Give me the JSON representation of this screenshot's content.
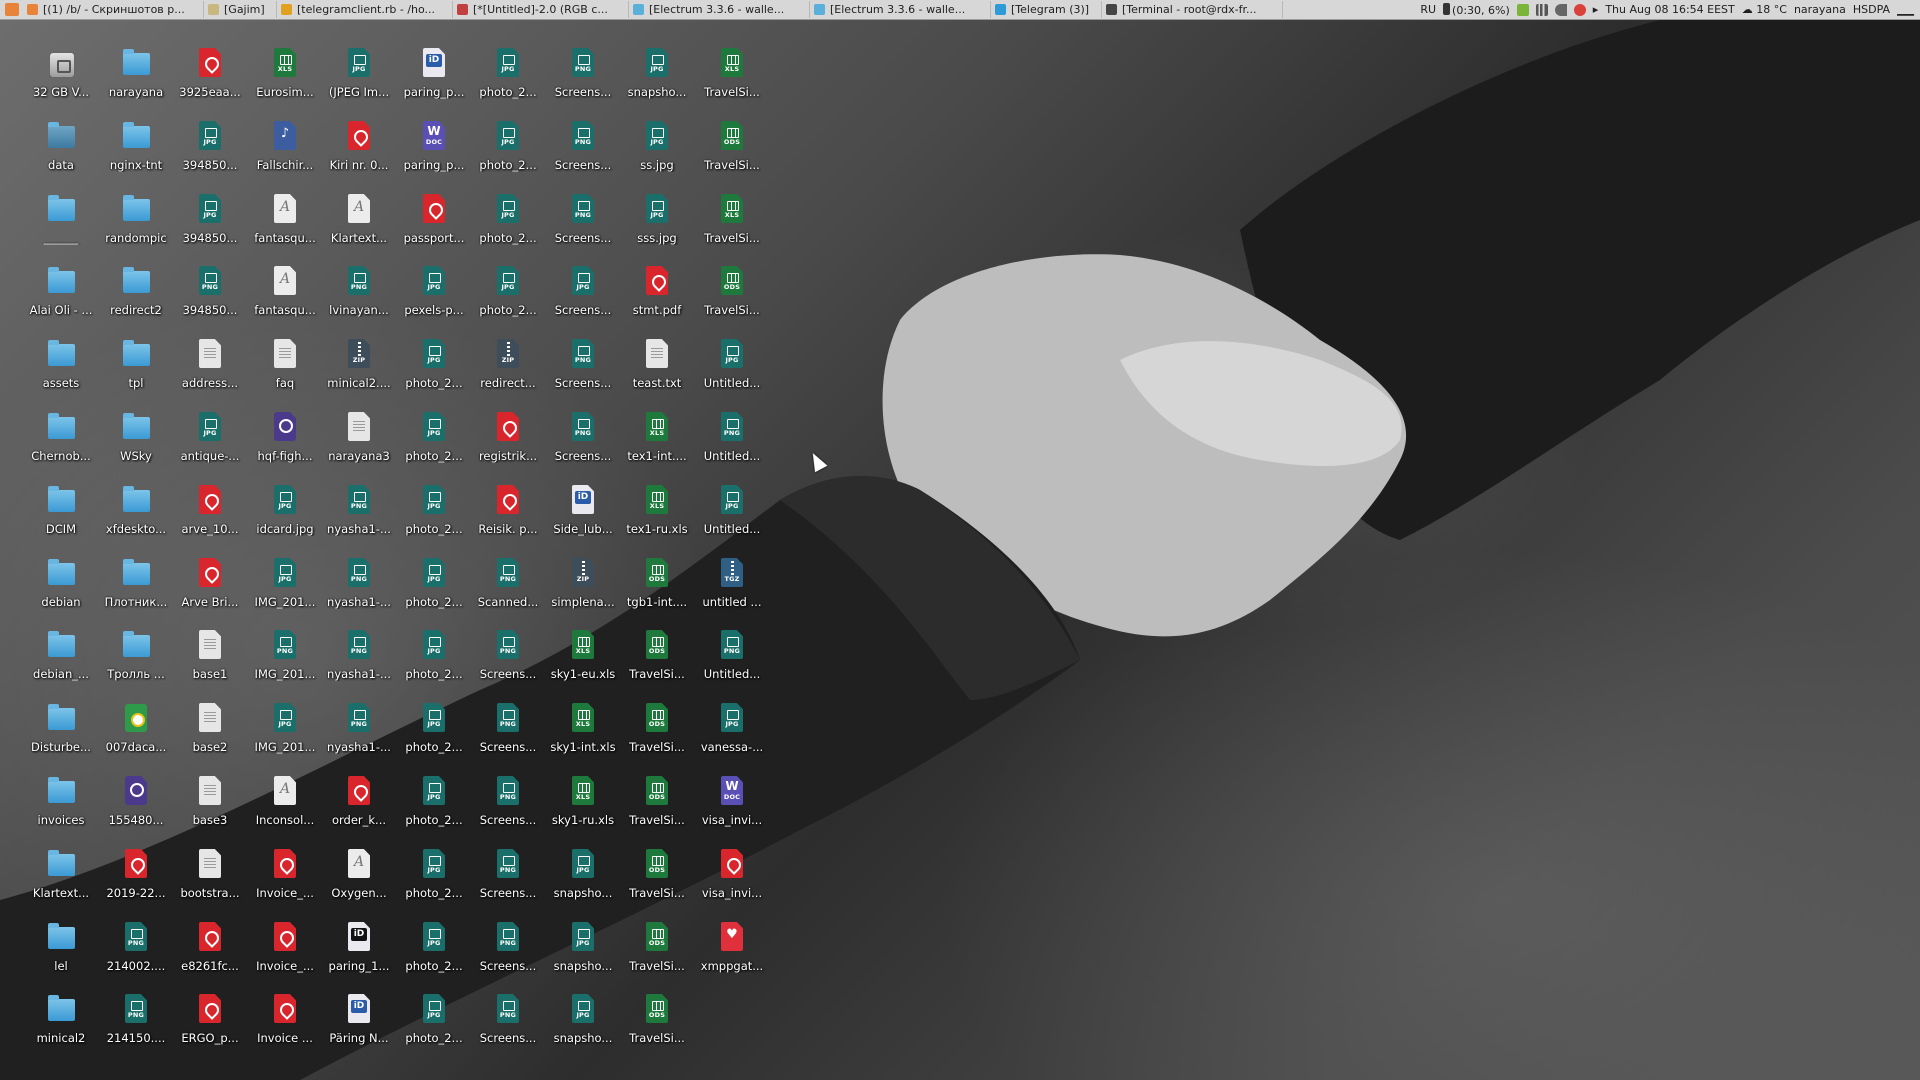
{
  "topbar": {
    "tasks": [
      {
        "label": "[(1) /b/ - Скриншотов р...",
        "icon": "browser-icon",
        "color": "#e8833a"
      },
      {
        "label": "[Gajim]",
        "icon": "chat-icon",
        "color": "#c8b880"
      },
      {
        "label": "[telegramclient.rb - /ho...",
        "icon": "editor-icon",
        "color": "#e0a020"
      },
      {
        "label": "[*[Untitled]-2.0 (RGB c...",
        "icon": "gimp-icon",
        "color": "#c04040"
      },
      {
        "label": "[Electrum 3.3.6 - walle...",
        "icon": "electrum-icon",
        "color": "#5ab0d8"
      },
      {
        "label": "[Electrum 3.3.6 - walle...",
        "icon": "electrum-icon",
        "color": "#5ab0d8"
      },
      {
        "label": "[Telegram (3)]",
        "icon": "telegram-icon",
        "color": "#2f9ad8"
      },
      {
        "label": "[Terminal - root@rdx-fr...",
        "icon": "terminal-icon",
        "color": "#444444"
      }
    ],
    "keyboard_layout": "RU",
    "battery": "(0:30, 6%)",
    "clock": "Thu Aug 08 16:54 EEST",
    "weather": "18 °C",
    "user": "narayana",
    "network": "HSDPA"
  },
  "desktop": {
    "columns": [
      [
        {
          "label": "32 GB V...",
          "type": "drive"
        },
        {
          "label": "data",
          "type": "netfolder"
        },
        {
          "label": "______",
          "type": "folder"
        },
        {
          "label": "Alai Oli - ...",
          "type": "folder"
        },
        {
          "label": "assets",
          "type": "folder"
        },
        {
          "label": "Chernob...",
          "type": "folder"
        },
        {
          "label": "DCIM",
          "type": "folder"
        },
        {
          "label": "debian",
          "type": "folder"
        },
        {
          "label": "debian_...",
          "type": "folder"
        },
        {
          "label": "Disturbe...",
          "type": "folder"
        },
        {
          "label": "invoices",
          "type": "folder"
        },
        {
          "label": "Klartext...",
          "type": "folder"
        },
        {
          "label": "lel",
          "type": "folder"
        },
        {
          "label": "minical2",
          "type": "folder"
        }
      ],
      [
        {
          "label": "narayana",
          "type": "folder"
        },
        {
          "label": "nginx-tnt",
          "type": "folder"
        },
        {
          "label": "randompic",
          "type": "folder"
        },
        {
          "label": "redirect2",
          "type": "folder"
        },
        {
          "label": "tpl",
          "type": "folder"
        },
        {
          "label": "WSky",
          "type": "folder"
        },
        {
          "label": "xfdeskto...",
          "type": "folder"
        },
        {
          "label": "Плотник...",
          "type": "folder"
        },
        {
          "label": "Тролль ...",
          "type": "folder"
        },
        {
          "label": "007daca...",
          "type": "chrome"
        },
        {
          "label": "155480...",
          "type": "video"
        },
        {
          "label": "2019-22...",
          "type": "pdf"
        },
        {
          "label": "214002....",
          "type": "png"
        },
        {
          "label": "214150....",
          "type": "png"
        }
      ],
      [
        {
          "label": "3925eaa...",
          "type": "pdf"
        },
        {
          "label": "394850...",
          "type": "jpg"
        },
        {
          "label": "394850...",
          "type": "jpg"
        },
        {
          "label": "394850...",
          "type": "png"
        },
        {
          "label": "address...",
          "type": "txt"
        },
        {
          "label": "antique-...",
          "type": "jpg"
        },
        {
          "label": "arve_10...",
          "type": "pdf"
        },
        {
          "label": "Arve Bri...",
          "type": "pdf"
        },
        {
          "label": "base1",
          "type": "txt"
        },
        {
          "label": "base2",
          "type": "txt"
        },
        {
          "label": "base3",
          "type": "txt"
        },
        {
          "label": "bootstra...",
          "type": "txt"
        },
        {
          "label": "e8261fc...",
          "type": "pdf"
        },
        {
          "label": "ERGO_p...",
          "type": "pdf"
        }
      ],
      [
        {
          "label": "Eurosim...",
          "type": "xls"
        },
        {
          "label": "Fallschir...",
          "type": "audio"
        },
        {
          "label": "fantasqu...",
          "type": "font"
        },
        {
          "label": "fantasqu...",
          "type": "font"
        },
        {
          "label": "faq",
          "type": "txt"
        },
        {
          "label": "hqf-figh...",
          "type": "video"
        },
        {
          "label": "idcard.jpg",
          "type": "jpg"
        },
        {
          "label": "IMG_201...",
          "type": "jpg"
        },
        {
          "label": "IMG_201...",
          "type": "png"
        },
        {
          "label": "IMG_201...",
          "type": "jpg"
        },
        {
          "label": "Inconsol...",
          "type": "font"
        },
        {
          "label": "Invoice_...",
          "type": "pdf"
        },
        {
          "label": "Invoice_...",
          "type": "pdf"
        },
        {
          "label": "Invoice ...",
          "type": "pdf"
        }
      ],
      [
        {
          "label": "(JPEG Im...",
          "type": "jpg"
        },
        {
          "label": "Kiri nr. 0...",
          "type": "pdf"
        },
        {
          "label": "Klartext...",
          "type": "font"
        },
        {
          "label": "lvinayan...",
          "type": "png"
        },
        {
          "label": "minical2....",
          "type": "zip"
        },
        {
          "label": "narayana3",
          "type": "txt"
        },
        {
          "label": "nyasha1-...",
          "type": "png"
        },
        {
          "label": "nyasha1-...",
          "type": "png"
        },
        {
          "label": "nyasha1-...",
          "type": "png"
        },
        {
          "label": "nyasha1-...",
          "type": "png"
        },
        {
          "label": "order_k...",
          "type": "pdf"
        },
        {
          "label": "Oxygen...",
          "type": "font"
        },
        {
          "label": "paring_1...",
          "type": "idcard2"
        },
        {
          "label": "Päring N...",
          "type": "idcard"
        }
      ],
      [
        {
          "label": "paring_p...",
          "type": "idcard"
        },
        {
          "label": "paring_p...",
          "type": "word"
        },
        {
          "label": "passport...",
          "type": "pdf"
        },
        {
          "label": "pexels-p...",
          "type": "jpg"
        },
        {
          "label": "photo_2...",
          "type": "jpg"
        },
        {
          "label": "photo_2...",
          "type": "jpg"
        },
        {
          "label": "photo_2...",
          "type": "jpg"
        },
        {
          "label": "photo_2...",
          "type": "jpg"
        },
        {
          "label": "photo_2...",
          "type": "jpg"
        },
        {
          "label": "photo_2...",
          "type": "jpg"
        },
        {
          "label": "photo_2...",
          "type": "jpg"
        },
        {
          "label": "photo_2...",
          "type": "jpg"
        },
        {
          "label": "photo_2...",
          "type": "jpg"
        },
        {
          "label": "photo_2...",
          "type": "jpg"
        }
      ],
      [
        {
          "label": "photo_2...",
          "type": "jpg"
        },
        {
          "label": "photo_2...",
          "type": "jpg"
        },
        {
          "label": "photo_2...",
          "type": "jpg"
        },
        {
          "label": "photo_2...",
          "type": "jpg"
        },
        {
          "label": "redirect...",
          "type": "zip"
        },
        {
          "label": "registrik...",
          "type": "pdf"
        },
        {
          "label": "Reisik. p...",
          "type": "pdf"
        },
        {
          "label": "Scanned...",
          "type": "png"
        },
        {
          "label": "Screens...",
          "type": "png"
        },
        {
          "label": "Screens...",
          "type": "png"
        },
        {
          "label": "Screens...",
          "type": "png"
        },
        {
          "label": "Screens...",
          "type": "png"
        },
        {
          "label": "Screens...",
          "type": "png"
        },
        {
          "label": "Screens...",
          "type": "png"
        }
      ],
      [
        {
          "label": "Screens...",
          "type": "png"
        },
        {
          "label": "Screens...",
          "type": "png"
        },
        {
          "label": "Screens...",
          "type": "png"
        },
        {
          "label": "Screens...",
          "type": "jpg"
        },
        {
          "label": "Screens...",
          "type": "png"
        },
        {
          "label": "Screens...",
          "type": "png"
        },
        {
          "label": "Side_lub...",
          "type": "idcard"
        },
        {
          "label": "simplena...",
          "type": "zip"
        },
        {
          "label": "sky1-eu.xls",
          "type": "xls"
        },
        {
          "label": "sky1-int.xls",
          "type": "xls"
        },
        {
          "label": "sky1-ru.xls",
          "type": "xls"
        },
        {
          "label": "snapsho...",
          "type": "jpg"
        },
        {
          "label": "snapsho...",
          "type": "jpg"
        },
        {
          "label": "snapsho...",
          "type": "jpg"
        }
      ],
      [
        {
          "label": "snapsho...",
          "type": "jpg"
        },
        {
          "label": "ss.jpg",
          "type": "jpg"
        },
        {
          "label": "sss.jpg",
          "type": "jpg"
        },
        {
          "label": "stmt.pdf",
          "type": "pdf"
        },
        {
          "label": "teast.txt",
          "type": "txt"
        },
        {
          "label": "tex1-int....",
          "type": "xls"
        },
        {
          "label": "tex1-ru.xls",
          "type": "xls"
        },
        {
          "label": "tgb1-int....",
          "type": "ods"
        },
        {
          "label": "TravelSi...",
          "type": "ods"
        },
        {
          "label": "TravelSi...",
          "type": "ods"
        },
        {
          "label": "TravelSi...",
          "type": "ods"
        },
        {
          "label": "TravelSi...",
          "type": "ods"
        },
        {
          "label": "TravelSi...",
          "type": "ods"
        },
        {
          "label": "TravelSi...",
          "type": "ods"
        }
      ],
      [
        {
          "label": "TravelSi...",
          "type": "xls"
        },
        {
          "label": "TravelSi...",
          "type": "ods"
        },
        {
          "label": "TravelSi...",
          "type": "xls"
        },
        {
          "label": "TravelSi...",
          "type": "ods"
        },
        {
          "label": "Untitled...",
          "type": "jpg"
        },
        {
          "label": "Untitled...",
          "type": "png"
        },
        {
          "label": "Untitled...",
          "type": "jpg"
        },
        {
          "label": "untitled ...",
          "type": "tgz"
        },
        {
          "label": "Untitled...",
          "type": "png"
        },
        {
          "label": "vanessa-...",
          "type": "jpg"
        },
        {
          "label": "visa_invi...",
          "type": "word"
        },
        {
          "label": "visa_invi...",
          "type": "pdf"
        },
        {
          "label": "xmppgat...",
          "type": "xmpp"
        }
      ]
    ],
    "type_tags": {
      "jpg": "JPG",
      "png": "PNG",
      "xls": "XLS",
      "ods": "ODS",
      "zip": "ZIP",
      "tgz": "TGZ",
      "word": "DOC",
      "idcard": "iD",
      "idcard2": "iD"
    }
  }
}
